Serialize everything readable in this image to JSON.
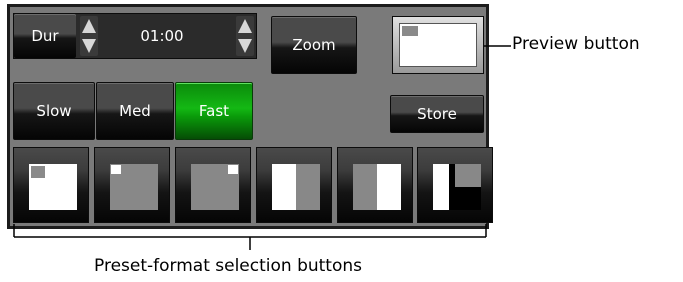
{
  "duration": {
    "label": "Dur",
    "value": "01:00"
  },
  "buttons": {
    "zoom": "Zoom",
    "store": "Store"
  },
  "speed": {
    "options": [
      "Slow",
      "Med",
      "Fast"
    ],
    "selected": "Fast"
  },
  "presets": [
    {
      "layout": "full-with-pip-top-left"
    },
    {
      "layout": "pip-top-left"
    },
    {
      "layout": "pip-top-right"
    },
    {
      "layout": "split-left-white"
    },
    {
      "layout": "split-right-white"
    },
    {
      "layout": "split-left-white-quad-right"
    }
  ],
  "annotations": {
    "preview": "Preview button",
    "presets": "Preset-format selection buttons"
  },
  "colors": {
    "panel": "#7a7a7a",
    "active": "#14b814",
    "button": "#0f0f0f"
  }
}
